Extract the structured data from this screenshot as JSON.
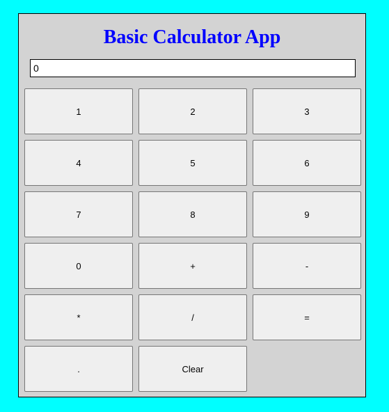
{
  "app": {
    "title": "Basic Calculator App",
    "display_value": "0"
  },
  "keys": [
    "1",
    "2",
    "3",
    "4",
    "5",
    "6",
    "7",
    "8",
    "9",
    "0",
    "+",
    "-",
    "*",
    "/",
    "=",
    ".",
    "Clear"
  ],
  "colors": {
    "page_background": "#00ffff",
    "panel_background": "#d3d3d3",
    "title_color": "#0000ff",
    "key_background": "#efefef"
  }
}
